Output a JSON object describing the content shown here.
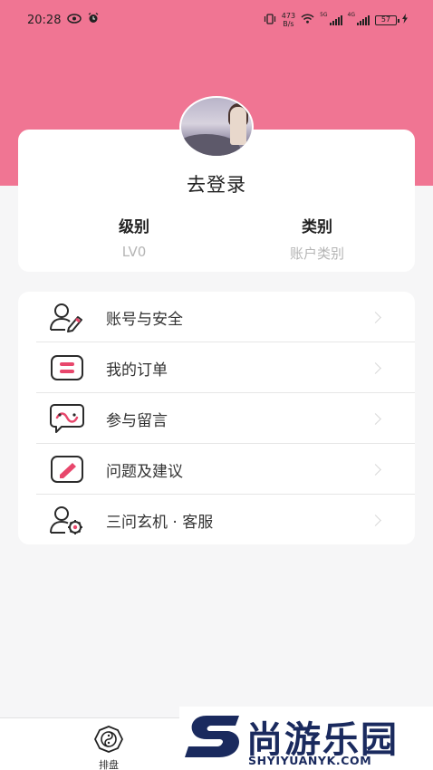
{
  "status_bar": {
    "time": "20:28",
    "net_speed_value": "473",
    "net_speed_unit": "B/s",
    "signal_1_label": "5G",
    "signal_2_label": "4G",
    "battery": "57"
  },
  "profile": {
    "login_label": "去登录",
    "level_label": "级别",
    "level_value": "LV0",
    "category_label": "类别",
    "category_value": "账户类别"
  },
  "menu": {
    "items": [
      {
        "label": "账号与安全",
        "icon": "user-edit-icon"
      },
      {
        "label": "我的订单",
        "icon": "order-list-icon"
      },
      {
        "label": "参与留言",
        "icon": "message-bubble-icon"
      },
      {
        "label": "问题及建议",
        "icon": "feedback-pencil-icon"
      },
      {
        "label": "三问玄机 · 客服",
        "icon": "customer-service-icon"
      }
    ]
  },
  "bottom_nav": {
    "paipan_label": "排盘"
  },
  "watermark": {
    "title": "尚游乐园",
    "subtitle": "SHYIYUANYK.COM"
  },
  "colors": {
    "header_pink": "#f07593",
    "icon_pink": "#e8476c",
    "icon_dark": "#2b2b2b",
    "muted_text": "#b5b5b5"
  }
}
